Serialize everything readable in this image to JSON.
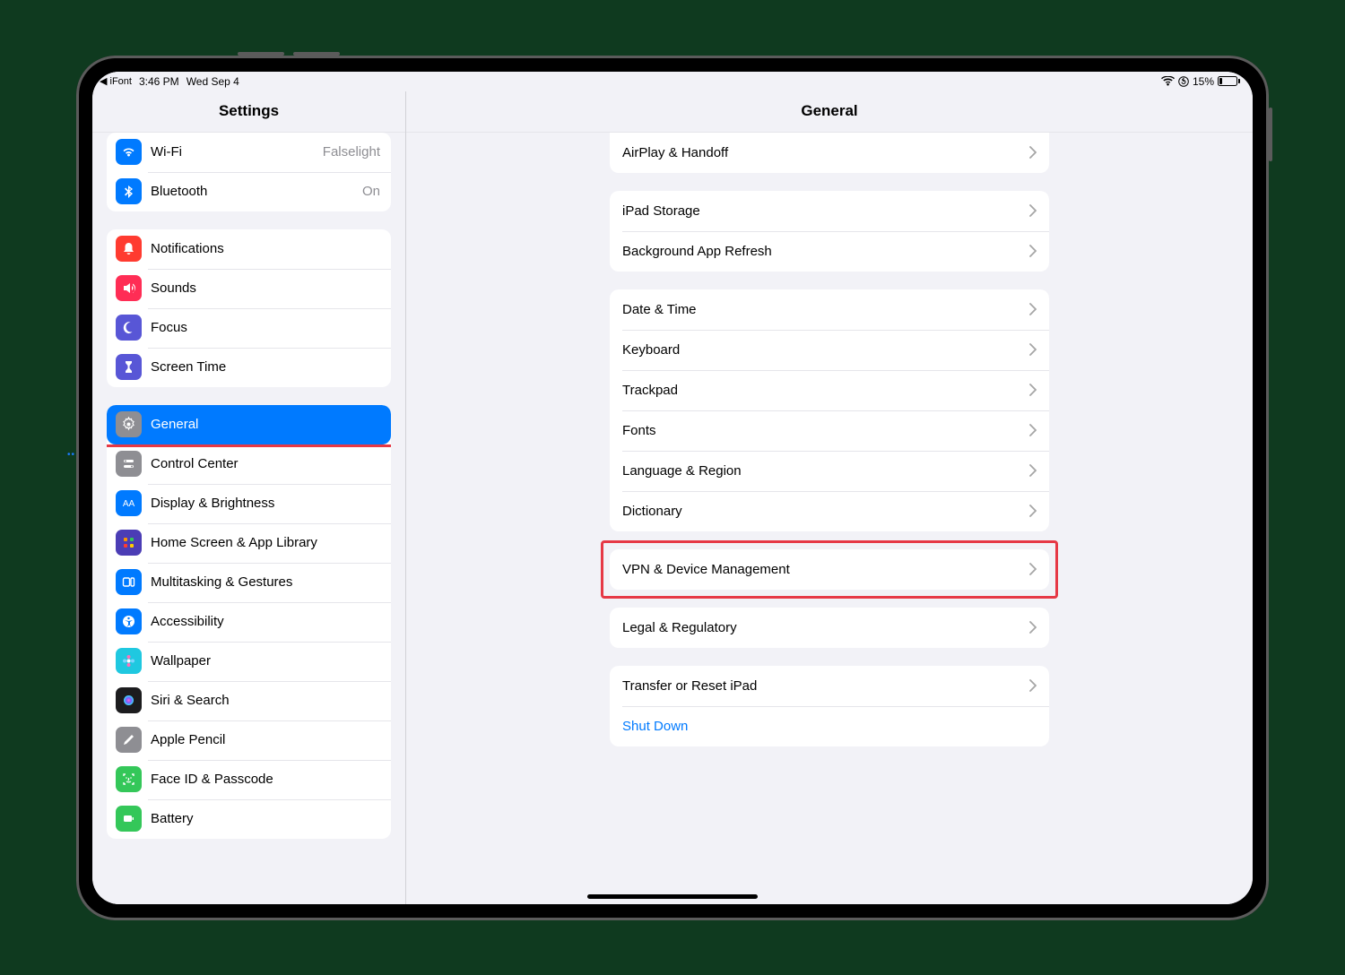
{
  "status": {
    "back_app": "◀ iFont",
    "time": "3:46 PM",
    "date": "Wed Sep 4",
    "battery_pct": "15%"
  },
  "sidebar": {
    "title": "Settings",
    "groups": [
      {
        "rows": [
          {
            "id": "wifi",
            "label": "Wi-Fi",
            "detail": "Falselight",
            "icon": "wifi-icon",
            "bg": "#007aff"
          },
          {
            "id": "bluetooth",
            "label": "Bluetooth",
            "detail": "On",
            "icon": "bluetooth-icon",
            "bg": "#007aff"
          }
        ]
      },
      {
        "rows": [
          {
            "id": "notifications",
            "label": "Notifications",
            "icon": "bell-icon",
            "bg": "#ff3b30"
          },
          {
            "id": "sounds",
            "label": "Sounds",
            "icon": "speaker-icon",
            "bg": "#ff2d55"
          },
          {
            "id": "focus",
            "label": "Focus",
            "icon": "moon-icon",
            "bg": "#5856d6"
          },
          {
            "id": "screentime",
            "label": "Screen Time",
            "icon": "hourglass-icon",
            "bg": "#5856d6"
          }
        ]
      },
      {
        "rows": [
          {
            "id": "general",
            "label": "General",
            "icon": "gear-icon",
            "bg": "#8e8e93",
            "selected": true,
            "highlighted": true
          },
          {
            "id": "controlcenter",
            "label": "Control Center",
            "icon": "switches-icon",
            "bg": "#8e8e93"
          },
          {
            "id": "display",
            "label": "Display & Brightness",
            "icon": "sun-icon",
            "bg": "#007aff"
          },
          {
            "id": "homescreen",
            "label": "Home Screen & App Library",
            "icon": "grid-icon",
            "bg": "#4b3db5"
          },
          {
            "id": "multitasking",
            "label": "Multitasking & Gestures",
            "icon": "windows-icon",
            "bg": "#007aff"
          },
          {
            "id": "accessibility",
            "label": "Accessibility",
            "icon": "accessibility-icon",
            "bg": "#007aff"
          },
          {
            "id": "wallpaper",
            "label": "Wallpaper",
            "icon": "flower-icon",
            "bg": "#1fc8e0"
          },
          {
            "id": "siri",
            "label": "Siri & Search",
            "icon": "siri-icon",
            "bg": "#1c1c1e"
          },
          {
            "id": "pencil",
            "label": "Apple Pencil",
            "icon": "pencil-icon",
            "bg": "#8e8e93"
          },
          {
            "id": "faceid",
            "label": "Face ID & Passcode",
            "icon": "faceid-icon",
            "bg": "#34c759"
          },
          {
            "id": "battery",
            "label": "Battery",
            "icon": "battery-icon",
            "bg": "#34c759"
          }
        ]
      }
    ]
  },
  "detail": {
    "title": "General",
    "groups": [
      {
        "rows": [
          {
            "id": "airplay",
            "label": "AirPlay & Handoff"
          }
        ]
      },
      {
        "rows": [
          {
            "id": "storage",
            "label": "iPad Storage"
          },
          {
            "id": "bgr",
            "label": "Background App Refresh"
          }
        ]
      },
      {
        "rows": [
          {
            "id": "datetime",
            "label": "Date & Time"
          },
          {
            "id": "keyboard",
            "label": "Keyboard"
          },
          {
            "id": "trackpad",
            "label": "Trackpad"
          },
          {
            "id": "fonts",
            "label": "Fonts"
          },
          {
            "id": "lang",
            "label": "Language & Region"
          },
          {
            "id": "dictionary",
            "label": "Dictionary"
          }
        ]
      },
      {
        "rows": [
          {
            "id": "vpn",
            "label": "VPN & Device Management",
            "highlighted": true
          }
        ]
      },
      {
        "rows": [
          {
            "id": "legal",
            "label": "Legal & Regulatory"
          }
        ]
      },
      {
        "rows": [
          {
            "id": "transfer",
            "label": "Transfer or Reset iPad"
          },
          {
            "id": "shutdown",
            "label": "Shut Down",
            "link": true,
            "no_chevron": true
          }
        ]
      }
    ]
  }
}
